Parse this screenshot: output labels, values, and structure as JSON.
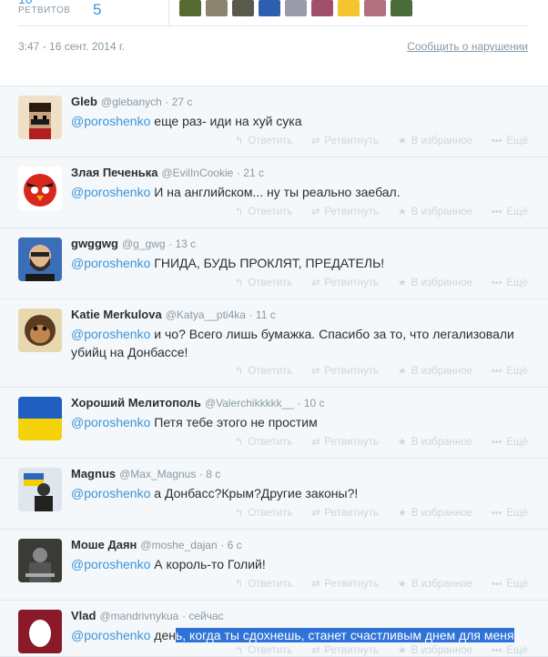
{
  "header": {
    "retweets_label": "РЕТВИТОВ",
    "retweets_count": "5",
    "retweets_top_partial": "10",
    "timestamp": "3:47 - 16 сент. 2014 г.",
    "report_link": "Сообщить о нарушении",
    "retweeter_colors": [
      "#556b2f",
      "#8a8470",
      "#5a5a4a",
      "#2d5fb0",
      "#9a9aa8",
      "#a0506a",
      "#f4c430",
      "#b07080",
      "#4b6b3b"
    ]
  },
  "actions": {
    "reply": "Ответить",
    "retweet": "Ретвитнуть",
    "favorite": "В избранное",
    "more": "Ещё"
  },
  "tweets": [
    {
      "name": "Gleb",
      "handle": "@glebanych",
      "time": "· 27 с",
      "mention": "@poroshenko",
      "text": " еще раз- иди на хуй сука",
      "avatar_color": "#c9a27a",
      "avatar_icon": "pixel-face-icon"
    },
    {
      "name": "Злая Печенька",
      "handle": "@EvilInCookie",
      "time": "· 21 с",
      "mention": "@poroshenko",
      "text": " И на английском... ну ты реально заебал.",
      "avatar_color": "#d8281e",
      "avatar_icon": "angry-bird-icon"
    },
    {
      "name": "gwggwg",
      "handle": "@g_gwg",
      "time": "· 13 с",
      "mention": "@poroshenko",
      "text": " ГНИДА, БУДЬ ПРОКЛЯТ, ПРЕДАТЕЛЬ!",
      "avatar_color": "#3a6fb8",
      "avatar_icon": "bearded-man-icon"
    },
    {
      "name": "Katie Merkulova",
      "handle": "@Katya__pti4ka",
      "time": "· 11 с",
      "mention": "@poroshenko",
      "text": " и чо? Всего лишь бумажка. Спасибо за то, что легализовали убийц на Донбассе!",
      "avatar_color": "#c08850",
      "avatar_icon": "monkey-icon"
    },
    {
      "name": "Хороший Мелитополь",
      "handle": "@Valerchikkkkk__",
      "time": "· 10 с",
      "mention": "@poroshenko",
      "text": " Петя тебе этого не простим",
      "avatar_color": "#1f5fbf",
      "avatar_icon": "ukraine-flag-icon"
    },
    {
      "name": "Magnus",
      "handle": "@Max_Magnus",
      "time": "· 8 с",
      "mention": "@poroshenko",
      "text": " а Донбасс?Крым?Другие законы?!",
      "avatar_color": "#6a7fa8",
      "avatar_icon": "person-flag-icon"
    },
    {
      "name": "Моше Даян",
      "handle": "@moshe_dajan",
      "time": "· 6 с",
      "mention": "@poroshenko",
      "text": " А король-то Голий!",
      "avatar_color": "#3a3a36",
      "avatar_icon": "soldier-icon"
    },
    {
      "name": "Vlad",
      "handle": "@mandrivnykua",
      "time": "· сейчас",
      "mention": "@poroshenko",
      "text_plain": " ден",
      "text_selected": "ь, когда ты сдохнешь, станет счастливым днем для меня",
      "avatar_color": "#8a1a28",
      "avatar_icon": "egg-icon"
    }
  ]
}
